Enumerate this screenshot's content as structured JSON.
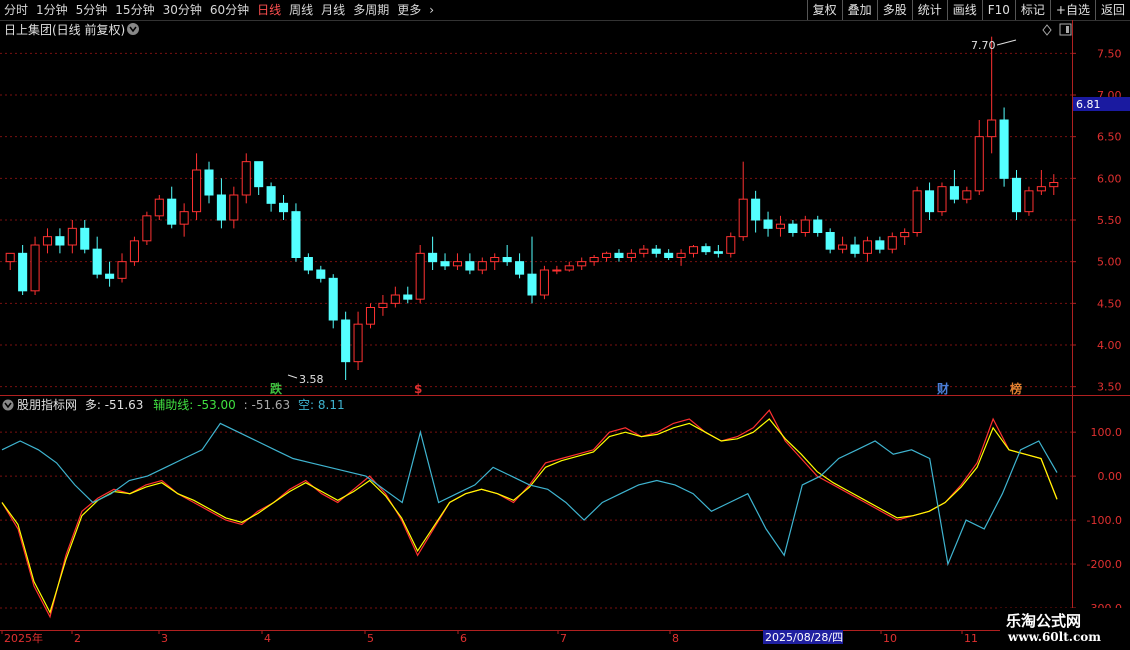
{
  "toolbar": {
    "periods": [
      {
        "label": "分时",
        "active": false
      },
      {
        "label": "1分钟",
        "active": false
      },
      {
        "label": "5分钟",
        "active": false
      },
      {
        "label": "15分钟",
        "active": false
      },
      {
        "label": "30分钟",
        "active": false
      },
      {
        "label": "60分钟",
        "active": false
      },
      {
        "label": "日线",
        "active": true
      },
      {
        "label": "周线",
        "active": false
      },
      {
        "label": "月线",
        "active": false
      },
      {
        "label": "多周期",
        "active": false
      },
      {
        "label": "更多",
        "active": false
      }
    ],
    "more_icon": "chevron-right-icon",
    "tools": [
      "复权",
      "叠加",
      "多股",
      "统计",
      "画线",
      "F10",
      "标记",
      "+自选",
      "返回"
    ]
  },
  "main_panel": {
    "title": "日上集团(日线 前复权)",
    "y_ticks": [
      "7.50",
      "7.00",
      "6.50",
      "6.00",
      "5.50",
      "5.00",
      "4.50",
      "4.00",
      "3.50"
    ],
    "current_price": "6.81",
    "high_label": "7.70",
    "low_label": "3.58",
    "event_markers": [
      {
        "text": "跌",
        "color": "#40c040"
      },
      {
        "text": "$",
        "color": "#e03030"
      },
      {
        "text": "财",
        "color": "#4a7fd8"
      },
      {
        "text": "榜",
        "color": "#e08030"
      }
    ]
  },
  "indicator_panel": {
    "name": "股朋指标网",
    "label_duo": "多:",
    "value_duo": "-51.63",
    "label_fuzhu": "辅助线:",
    "value_fuzhu": "-53.00",
    "value_extra": ": -51.63",
    "label_kong": "空:",
    "value_kong": "8.11",
    "y_ticks": [
      "100.0",
      "0.00",
      "-100.0",
      "-200.0",
      "-300.0"
    ]
  },
  "x_axis": {
    "labels": [
      "2025年",
      "2",
      "3",
      "4",
      "5",
      "6",
      "7",
      "8",
      "10",
      "11"
    ],
    "cursor_date": "2025/08/28/四"
  },
  "watermark": {
    "line1": "乐淘公式网",
    "line2": "www.60lt.com"
  },
  "colors": {
    "up": "#ff3232",
    "down": "#54ffff",
    "duo": "#ff3030",
    "fuzhu": "#ffff00",
    "kong": "#3fb4d0",
    "grid": "#7a1010",
    "axis": "#b02020"
  },
  "chart_data": {
    "type": "candlestick",
    "price_ylim": [
      3.4,
      7.9
    ],
    "price_series": [
      [
        5.0,
        5.1,
        4.9,
        5.1
      ],
      [
        5.1,
        5.2,
        4.6,
        4.65
      ],
      [
        4.65,
        5.3,
        4.6,
        5.2
      ],
      [
        5.2,
        5.4,
        5.1,
        5.3
      ],
      [
        5.3,
        5.4,
        5.1,
        5.2
      ],
      [
        5.2,
        5.5,
        5.1,
        5.4
      ],
      [
        5.4,
        5.5,
        5.1,
        5.15
      ],
      [
        5.15,
        5.3,
        4.8,
        4.85
      ],
      [
        4.85,
        5.0,
        4.7,
        4.8
      ],
      [
        4.8,
        5.1,
        4.75,
        5.0
      ],
      [
        5.0,
        5.3,
        4.95,
        5.25
      ],
      [
        5.25,
        5.6,
        5.2,
        5.55
      ],
      [
        5.55,
        5.8,
        5.5,
        5.75
      ],
      [
        5.75,
        5.9,
        5.4,
        5.45
      ],
      [
        5.45,
        5.7,
        5.3,
        5.6
      ],
      [
        5.6,
        6.3,
        5.5,
        6.1
      ],
      [
        6.1,
        6.2,
        5.7,
        5.8
      ],
      [
        5.8,
        6.0,
        5.4,
        5.5
      ],
      [
        5.5,
        5.9,
        5.4,
        5.8
      ],
      [
        5.8,
        6.3,
        5.7,
        6.2
      ],
      [
        6.2,
        6.2,
        5.8,
        5.9
      ],
      [
        5.9,
        5.95,
        5.6,
        5.7
      ],
      [
        5.7,
        5.8,
        5.5,
        5.6
      ],
      [
        5.6,
        5.7,
        5.0,
        5.05
      ],
      [
        5.05,
        5.1,
        4.85,
        4.9
      ],
      [
        4.9,
        4.95,
        4.75,
        4.8
      ],
      [
        4.8,
        4.85,
        4.2,
        4.3
      ],
      [
        4.3,
        4.4,
        3.58,
        3.8
      ],
      [
        3.8,
        4.4,
        3.7,
        4.25
      ],
      [
        4.25,
        4.5,
        4.2,
        4.45
      ],
      [
        4.45,
        4.6,
        4.35,
        4.5
      ],
      [
        4.5,
        4.7,
        4.45,
        4.6
      ],
      [
        4.6,
        4.7,
        4.5,
        4.55
      ],
      [
        4.55,
        5.2,
        4.5,
        5.1
      ],
      [
        5.1,
        5.3,
        4.9,
        5.0
      ],
      [
        5.0,
        5.1,
        4.9,
        4.95
      ],
      [
        4.95,
        5.1,
        4.9,
        5.0
      ],
      [
        5.0,
        5.1,
        4.85,
        4.9
      ],
      [
        4.9,
        5.05,
        4.85,
        5.0
      ],
      [
        5.0,
        5.1,
        4.9,
        5.05
      ],
      [
        5.05,
        5.2,
        4.95,
        5.0
      ],
      [
        5.0,
        5.1,
        4.8,
        4.85
      ],
      [
        4.85,
        5.3,
        4.5,
        4.6
      ],
      [
        4.6,
        4.95,
        4.55,
        4.9
      ],
      [
        4.9,
        4.95,
        4.85,
        4.9
      ],
      [
        4.9,
        5.0,
        4.88,
        4.95
      ],
      [
        4.95,
        5.05,
        4.9,
        5.0
      ],
      [
        5.0,
        5.08,
        4.95,
        5.05
      ],
      [
        5.05,
        5.12,
        5.0,
        5.1
      ],
      [
        5.1,
        5.15,
        5.0,
        5.05
      ],
      [
        5.05,
        5.15,
        5.0,
        5.1
      ],
      [
        5.1,
        5.2,
        5.05,
        5.15
      ],
      [
        5.15,
        5.2,
        5.05,
        5.1
      ],
      [
        5.1,
        5.15,
        5.02,
        5.05
      ],
      [
        5.05,
        5.15,
        4.95,
        5.1
      ],
      [
        5.1,
        5.2,
        5.05,
        5.18
      ],
      [
        5.18,
        5.22,
        5.08,
        5.12
      ],
      [
        5.12,
        5.2,
        5.05,
        5.1
      ],
      [
        5.1,
        5.35,
        5.05,
        5.3
      ],
      [
        5.3,
        6.2,
        5.25,
        5.75
      ],
      [
        5.75,
        5.85,
        5.35,
        5.5
      ],
      [
        5.5,
        5.6,
        5.3,
        5.4
      ],
      [
        5.4,
        5.55,
        5.3,
        5.45
      ],
      [
        5.45,
        5.5,
        5.3,
        5.35
      ],
      [
        5.35,
        5.55,
        5.3,
        5.5
      ],
      [
        5.5,
        5.55,
        5.3,
        5.35
      ],
      [
        5.35,
        5.4,
        5.1,
        5.15
      ],
      [
        5.15,
        5.3,
        5.1,
        5.2
      ],
      [
        5.2,
        5.3,
        5.05,
        5.1
      ],
      [
        5.1,
        5.3,
        5.0,
        5.25
      ],
      [
        5.25,
        5.3,
        5.1,
        5.15
      ],
      [
        5.15,
        5.35,
        5.1,
        5.3
      ],
      [
        5.3,
        5.4,
        5.2,
        5.35
      ],
      [
        5.35,
        5.9,
        5.3,
        5.85
      ],
      [
        5.85,
        5.95,
        5.5,
        5.6
      ],
      [
        5.6,
        5.95,
        5.55,
        5.9
      ],
      [
        5.9,
        6.1,
        5.7,
        5.75
      ],
      [
        5.75,
        5.9,
        5.7,
        5.85
      ],
      [
        5.85,
        6.7,
        5.8,
        6.5
      ],
      [
        6.5,
        7.7,
        6.3,
        6.7
      ],
      [
        6.7,
        6.85,
        5.9,
        6.0
      ],
      [
        6.0,
        6.1,
        5.5,
        5.6
      ],
      [
        5.6,
        5.9,
        5.55,
        5.85
      ],
      [
        5.85,
        6.1,
        5.8,
        5.9
      ],
      [
        5.9,
        6.05,
        5.8,
        5.95
      ]
    ],
    "indicator_ylim": [
      -350,
      180
    ],
    "series": [
      {
        "name": "多",
        "values": [
          -60,
          -120,
          -250,
          -320,
          -180,
          -80,
          -50,
          -30,
          -40,
          -20,
          -10,
          -40,
          -60,
          -80,
          -100,
          -110,
          -80,
          -60,
          -30,
          -10,
          -40,
          -60,
          -30,
          0,
          -40,
          -100,
          -180,
          -120,
          -60,
          -40,
          -30,
          -40,
          -60,
          -20,
          30,
          40,
          50,
          60,
          100,
          110,
          90,
          100,
          120,
          130,
          100,
          80,
          90,
          110,
          150,
          80,
          40,
          0,
          -20,
          -40,
          -60,
          -80,
          -100,
          -90,
          -80,
          -60,
          -20,
          30,
          130,
          60,
          50,
          40,
          -51.63
        ]
      },
      {
        "name": "辅助线",
        "values": [
          -60,
          -110,
          -240,
          -310,
          -190,
          -90,
          -55,
          -35,
          -40,
          -25,
          -15,
          -40,
          -55,
          -75,
          -95,
          -105,
          -85,
          -60,
          -35,
          -15,
          -35,
          -55,
          -35,
          -10,
          -45,
          -95,
          -170,
          -115,
          -60,
          -40,
          -30,
          -40,
          -55,
          -25,
          20,
          35,
          45,
          55,
          90,
          100,
          90,
          95,
          110,
          120,
          100,
          80,
          85,
          100,
          130,
          85,
          50,
          10,
          -15,
          -35,
          -55,
          -75,
          -95,
          -90,
          -80,
          -60,
          -25,
          20,
          110,
          60,
          50,
          40,
          -53.0
        ]
      },
      {
        "name": "空",
        "values": [
          60,
          80,
          60,
          30,
          -20,
          -60,
          -40,
          -10,
          0,
          20,
          40,
          60,
          120,
          100,
          80,
          60,
          40,
          30,
          20,
          10,
          0,
          -30,
          -60,
          100,
          -60,
          -40,
          -20,
          20,
          0,
          -20,
          -30,
          -60,
          -100,
          -60,
          -40,
          -20,
          -10,
          -20,
          -40,
          -80,
          -60,
          -40,
          -120,
          -180,
          -20,
          0,
          40,
          60,
          80,
          50,
          60,
          40,
          -200,
          -100,
          -120,
          -40,
          60,
          80,
          8.11
        ]
      }
    ]
  }
}
